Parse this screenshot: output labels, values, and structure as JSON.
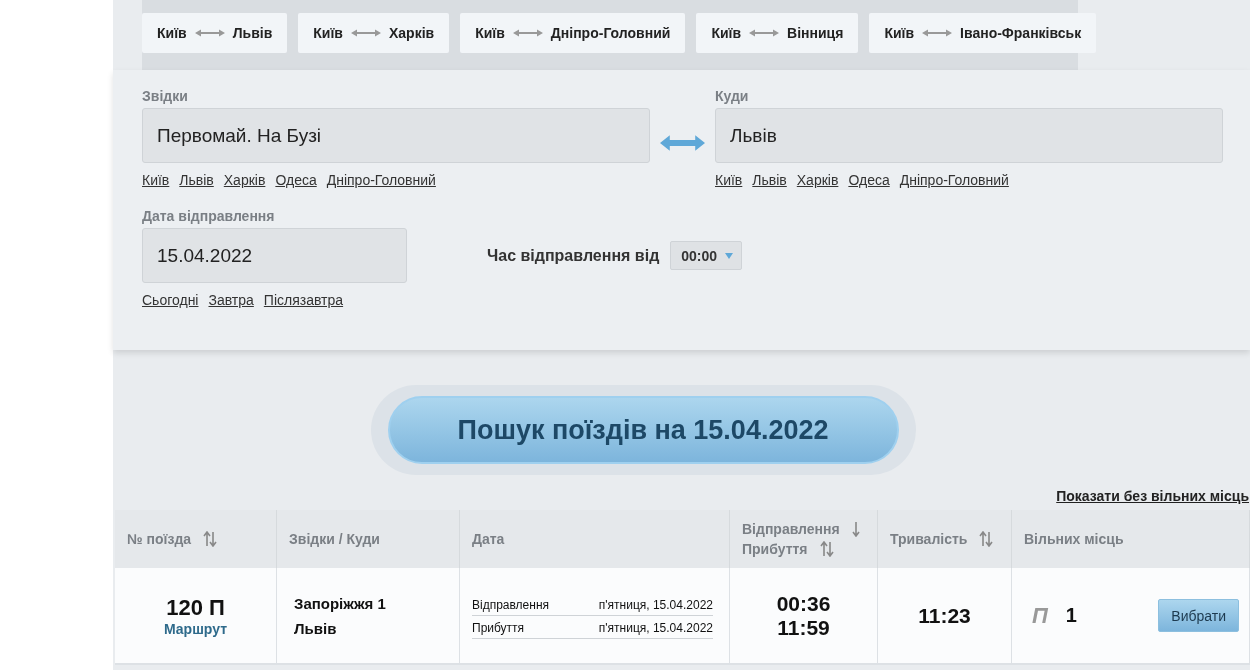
{
  "popular_routes": [
    {
      "from": "Київ",
      "to": "Львів"
    },
    {
      "from": "Київ",
      "to": "Харків"
    },
    {
      "from": "Київ",
      "to": "Дніпро-Головний"
    },
    {
      "from": "Київ",
      "to": "Вінниця"
    },
    {
      "from": "Київ",
      "to": "Івано-Франківськ"
    }
  ],
  "from": {
    "label": "Звідки",
    "value": "Первомай. На Бузі",
    "quick_links": [
      "Київ",
      "Львів",
      "Харків",
      "Одеса",
      "Дніпро-Головний"
    ]
  },
  "to": {
    "label": "Куди",
    "value": "Львів",
    "quick_links": [
      "Київ",
      "Львів",
      "Харків",
      "Одеса",
      "Дніпро-Головний"
    ]
  },
  "date": {
    "label": "Дата відправлення",
    "value": "15.04.2022",
    "quick_links": [
      "Сьогодні",
      "Завтра",
      "Післязавтра"
    ]
  },
  "time": {
    "label": "Час відправлення від",
    "value": "00:00"
  },
  "search_button": "Пошук поїздів на 15.04.2022",
  "show_all_link": "Показати без вільних місць",
  "table": {
    "columns": [
      {
        "lines": [
          {
            "label": "№ поїзда",
            "sort_up": true,
            "sort_down": true
          }
        ]
      },
      {
        "lines": [
          {
            "label": "Звідки / Куди",
            "sort_up": false,
            "sort_down": false
          }
        ]
      },
      {
        "lines": [
          {
            "label": "Дата",
            "sort_up": false,
            "sort_down": false
          }
        ]
      },
      {
        "lines": [
          {
            "label": "Відправлення",
            "sort_up": false,
            "sort_down": true
          },
          {
            "label": "Прибуття",
            "sort_up": true,
            "sort_down": true
          }
        ]
      },
      {
        "lines": [
          {
            "label": "Тривалість",
            "sort_up": true,
            "sort_down": true
          }
        ]
      },
      {
        "lines": [
          {
            "label": "Вільних місць",
            "sort_up": false,
            "sort_down": false
          }
        ]
      }
    ],
    "rows": [
      {
        "train": "120 П",
        "route_link": "Маршрут",
        "from": "Запоріжжя 1",
        "to": "Львів",
        "dates": [
          {
            "label": "Відправлення",
            "value": "п'ятниця, 15.04.2022"
          },
          {
            "label": "Прибуття",
            "value": "п'ятниця, 15.04.2022"
          }
        ],
        "departure": "00:36",
        "arrival": "11:59",
        "duration": "11:23",
        "seats": [
          {
            "class": "П",
            "count": "1"
          }
        ],
        "button": "Вибрати"
      }
    ]
  }
}
